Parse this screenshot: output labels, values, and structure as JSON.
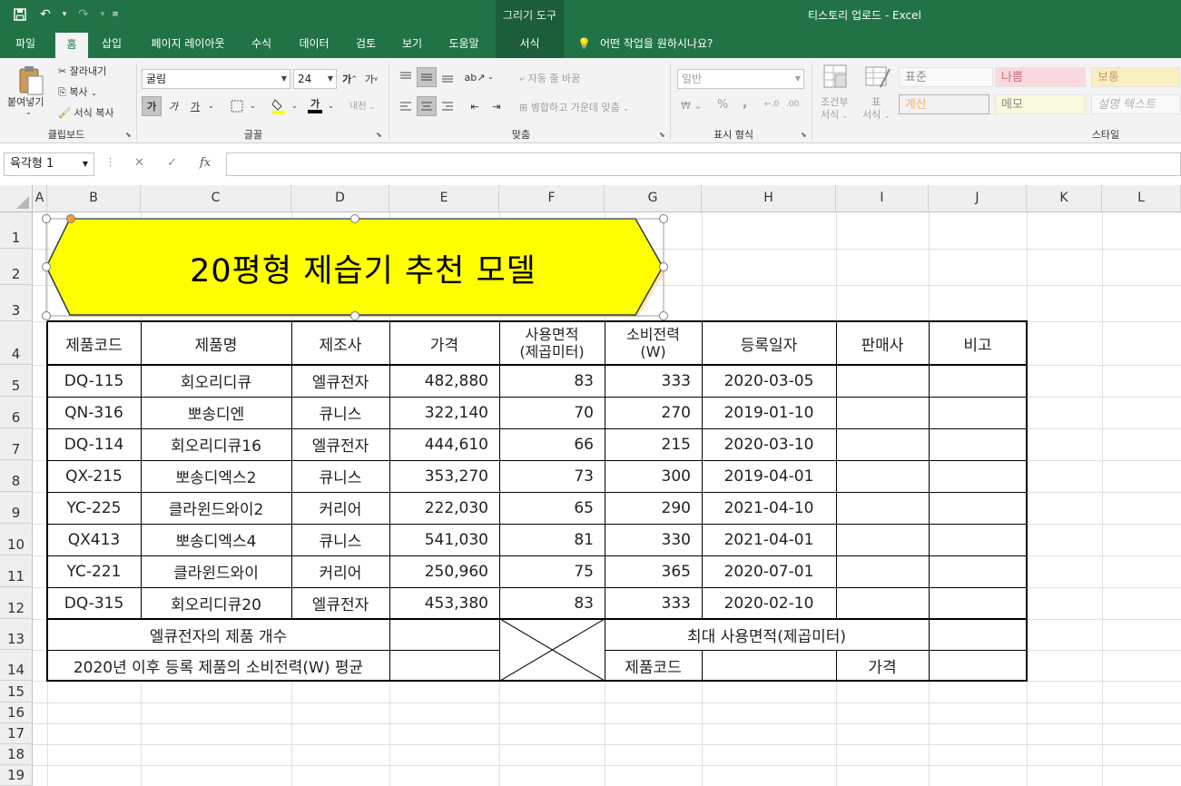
{
  "window": {
    "title": "티스토리 업로드  -  Excel",
    "contextual_tab": "그리기 도구"
  },
  "quick_access": {
    "save": "save-icon",
    "undo": "undo-icon",
    "redo": "redo-icon",
    "customize": "customize-icon"
  },
  "ribbon_tabs": [
    "파일",
    "홈",
    "삽입",
    "페이지 레이아웃",
    "수식",
    "데이터",
    "검토",
    "보기",
    "도움말",
    "서식"
  ],
  "active_tab": "홈",
  "tell_me": "어떤 작업을 원하시나요?",
  "clipboard": {
    "paste": "붙여넣기",
    "cut": "잘라내기",
    "copy": "복사",
    "format_painter": "서식 복사",
    "label": "클립보드"
  },
  "font": {
    "name": "굴림",
    "size": "24",
    "bold": "가",
    "italic": "가",
    "underline": "가",
    "wrap_hint": "내천",
    "label": "글꼴"
  },
  "alignment": {
    "wrap": "자동 줄 바꿈",
    "merge": "병합하고 가운데 맞춤",
    "label": "맞춤"
  },
  "number": {
    "format": "일반",
    "percent": "%",
    "comma": ",",
    "label": "표시 형식"
  },
  "styles": {
    "conditional": [
      "조건부",
      "서식"
    ],
    "table": [
      "표",
      "서식"
    ],
    "cells": [
      {
        "label": "표준",
        "bg": "#ffffff",
        "color": "#333333"
      },
      {
        "label": "나쁨",
        "bg": "#ffc7ce",
        "color": "#9c0006"
      },
      {
        "label": "보통",
        "bg": "#ffeb9c",
        "color": "#9c5700"
      },
      {
        "label": "계산",
        "bg": "#f2f2f2",
        "color": "#fa7d00"
      },
      {
        "label": "메모",
        "bg": "#ffffcc",
        "color": "#333333"
      },
      {
        "label": "설명 텍스트",
        "bg": "#ffffff",
        "color": "#7f7f7f"
      }
    ],
    "label": "스타일"
  },
  "formula_bar": {
    "name_box": "육각형 1",
    "fx": "fx",
    "value": ""
  },
  "columns": [
    "A",
    "B",
    "C",
    "D",
    "E",
    "F",
    "G",
    "H",
    "I",
    "J",
    "K",
    "L"
  ],
  "rows": [
    "1",
    "2",
    "3",
    "4",
    "5",
    "6",
    "7",
    "8",
    "9",
    "10",
    "11",
    "12",
    "13",
    "14",
    "15",
    "16",
    "17",
    "18",
    "19"
  ],
  "shape": {
    "text": "20평형 제습기 추천 모델",
    "fill": "#ffff00"
  },
  "table": {
    "headers": [
      "제품코드",
      "제품명",
      "제조사",
      "가격",
      "사용면적\n(제곱미터)",
      "소비전력\n(W)",
      "등록일자",
      "판매사",
      "비고"
    ],
    "header_lines": [
      [
        "제품코드"
      ],
      [
        "제품명"
      ],
      [
        "제조사"
      ],
      [
        "가격"
      ],
      [
        "사용면적",
        "(제곱미터)"
      ],
      [
        "소비전력",
        "(W)"
      ],
      [
        "등록일자"
      ],
      [
        "판매사"
      ],
      [
        "비고"
      ]
    ],
    "rows": [
      [
        "DQ-115",
        "회오리디큐",
        "엘큐전자",
        "482,880",
        "83",
        "333",
        "2020-03-05",
        "",
        ""
      ],
      [
        "QN-316",
        "뽀송디엔",
        "큐니스",
        "322,140",
        "70",
        "270",
        "2019-01-10",
        "",
        ""
      ],
      [
        "DQ-114",
        "회오리디큐16",
        "엘큐전자",
        "444,610",
        "66",
        "215",
        "2020-03-10",
        "",
        ""
      ],
      [
        "QX-215",
        "뽀송디엑스2",
        "큐니스",
        "353,270",
        "73",
        "300",
        "2019-04-01",
        "",
        ""
      ],
      [
        "YC-225",
        "클라윈드와이2",
        "커리어",
        "222,030",
        "65",
        "290",
        "2021-04-10",
        "",
        ""
      ],
      [
        "QX413",
        "뽀송디엑스4",
        "큐니스",
        "541,030",
        "81",
        "330",
        "2021-04-01",
        "",
        ""
      ],
      [
        "YC-221",
        "클라윈드와이",
        "커리어",
        "250,960",
        "75",
        "365",
        "2020-07-01",
        "",
        ""
      ],
      [
        "DQ-315",
        "회오리디큐20",
        "엘큐전자",
        "453,380",
        "83",
        "333",
        "2020-02-10",
        "",
        ""
      ]
    ],
    "summary": {
      "lq_count_label": "엘큐전자의 제품 개수",
      "avg_label": "2020년 이후 등록 제품의 소비전력(W) 평균",
      "max_area_label": "최대 사용면적(제곱미터)",
      "code_label": "제품코드",
      "price_label": "가격"
    }
  }
}
